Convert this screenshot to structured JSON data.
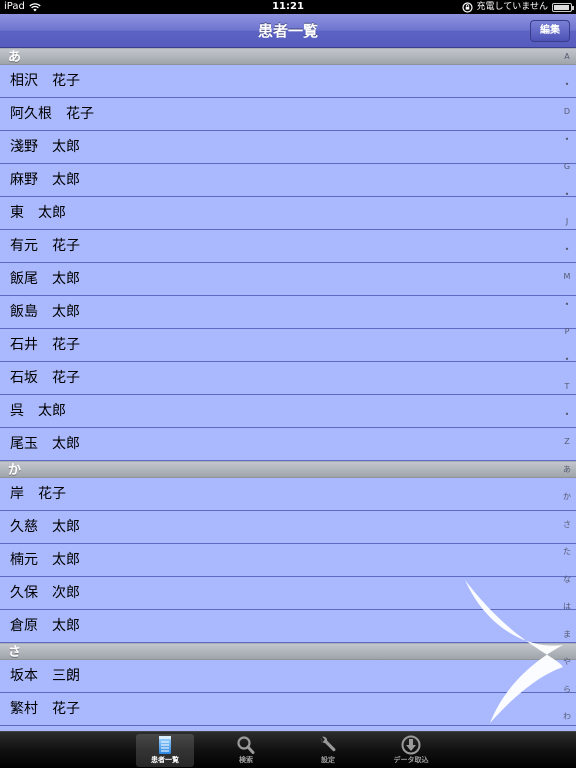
{
  "status_bar": {
    "device": "iPad",
    "time": "11:21",
    "charging_text": "充電していません"
  },
  "nav_bar": {
    "title": "患者一覧",
    "edit_label": "編集"
  },
  "sections": [
    {
      "header": "あ",
      "rows": [
        "相沢　花子",
        "阿久根　花子",
        "淺野　太郎",
        "麻野　太郎",
        "東　太郎",
        "有元　花子",
        "飯尾　太郎",
        "飯島　太郎",
        "石井　花子",
        "石坂　花子",
        "呉　太郎",
        "尾玉　太郎"
      ]
    },
    {
      "header": "か",
      "rows": [
        "岸　花子",
        "久慈　太郎",
        "楠元　太郎",
        "久保　次郎",
        "倉原　太郎"
      ]
    },
    {
      "header": "さ",
      "rows": [
        "坂本　三朗",
        "繁村　花子"
      ]
    }
  ],
  "index_bar": [
    "A",
    "•",
    "D",
    "•",
    "G",
    "•",
    "J",
    "•",
    "M",
    "•",
    "P",
    "•",
    "T",
    "•",
    "Z",
    "あ",
    "か",
    "さ",
    "た",
    "な",
    "は",
    "ま",
    "や",
    "ら",
    "わ"
  ],
  "tab_bar": {
    "tabs": [
      {
        "label": "患者一覧",
        "icon": "notepad-icon",
        "selected": true
      },
      {
        "label": "検索",
        "icon": "magnifier-icon",
        "selected": false
      },
      {
        "label": "設定",
        "icon": "wrench-icon",
        "selected": false
      },
      {
        "label": "データ取込",
        "icon": "download-icon",
        "selected": false
      }
    ]
  },
  "colors": {
    "row_background": "#aab8fd",
    "row_separator": "#5d6bc4",
    "nav_bar": "#6e74cf",
    "section_header": "#b0b5bc"
  }
}
